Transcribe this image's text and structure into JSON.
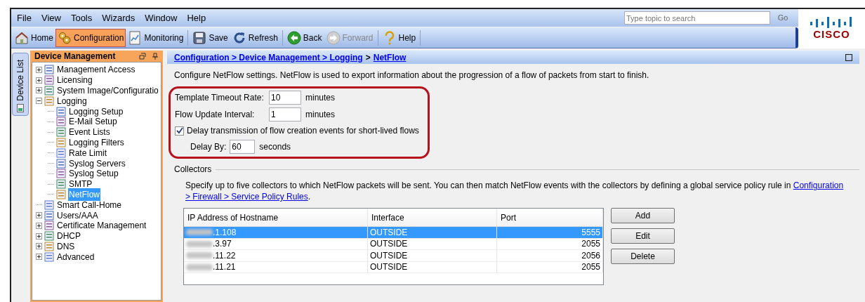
{
  "menu": [
    "File",
    "View",
    "Tools",
    "Wizards",
    "Window",
    "Help"
  ],
  "search": {
    "placeholder": "Type topic to search",
    "button": "Go"
  },
  "logo": "CISCO",
  "toolbar": [
    {
      "label": "Home",
      "kind": "home",
      "selected": false,
      "disabled": false
    },
    {
      "label": "Configuration",
      "kind": "gears",
      "selected": true,
      "disabled": false
    },
    {
      "label": "Monitoring",
      "kind": "chart",
      "selected": false,
      "disabled": false
    },
    {
      "label": "Save",
      "kind": "disk",
      "selected": false,
      "disabled": false
    },
    {
      "label": "Refresh",
      "kind": "refresh",
      "selected": false,
      "disabled": false
    },
    {
      "label": "Back",
      "kind": "back",
      "selected": false,
      "disabled": false
    },
    {
      "label": "Forward",
      "kind": "forward",
      "selected": false,
      "disabled": true
    },
    {
      "label": "Help",
      "kind": "help",
      "selected": false,
      "disabled": false
    }
  ],
  "side_tab": "Device List",
  "sidebar": {
    "title": "Device Management",
    "items": [
      {
        "label": "Management Access",
        "expanded": false,
        "selected": false
      },
      {
        "label": "Licensing",
        "expanded": false,
        "selected": false
      },
      {
        "label": "System Image/Configuratio",
        "expanded": false,
        "selected": false
      },
      {
        "label": "Logging",
        "expanded": true,
        "selected": false,
        "children": [
          {
            "label": "Logging Setup",
            "selected": false
          },
          {
            "label": "E-Mail Setup",
            "selected": false
          },
          {
            "label": "Event Lists",
            "selected": false
          },
          {
            "label": "Logging Filters",
            "selected": false
          },
          {
            "label": "Rate Limit",
            "selected": false
          },
          {
            "label": "Syslog Servers",
            "selected": false
          },
          {
            "label": "Syslog Setup",
            "selected": false
          },
          {
            "label": "SMTP",
            "selected": false
          },
          {
            "label": "NetFlow",
            "selected": true
          }
        ]
      },
      {
        "label": "Smart Call-Home",
        "selected": false
      },
      {
        "label": "Users/AAA",
        "expanded": false,
        "selected": false
      },
      {
        "label": "Certificate Management",
        "expanded": false,
        "selected": false
      },
      {
        "label": "DHCP",
        "expanded": false,
        "selected": false
      },
      {
        "label": "DNS",
        "expanded": false,
        "selected": false
      },
      {
        "label": "Advanced",
        "expanded": false,
        "selected": false
      }
    ]
  },
  "breadcrumb": [
    {
      "label": "Configuration > Device Management > Logging",
      "link": true
    },
    {
      "label": ">",
      "link": false
    },
    {
      "label": "NetFlow",
      "link": true
    }
  ],
  "description": "Configure NetFlow settings. NetFlow is used to export information about the progression of a flow of packets from start to finish.",
  "settings": {
    "template_timeout": {
      "label": "Template Timeout Rate:",
      "value": "10",
      "unit": "minutes"
    },
    "flow_update": {
      "label": "Flow Update Interval:",
      "value": "1",
      "unit": "minutes"
    },
    "delay": {
      "label": "Delay transmission of flow creation events for short-lived flows",
      "checked": true
    },
    "delay_by": {
      "label": "Delay By:",
      "value": "60",
      "unit": "seconds"
    }
  },
  "collectors": {
    "title": "Collectors",
    "text": "Specify up to five collectors to which NetFlow packets will be sent. You can then match NetFlow events with the collectors by defining a global service policy rule in ",
    "link_1": "Configuration",
    "link_2": "> Firewall > Service Policy Rules",
    "end": ".",
    "columns": [
      "IP Address of Hostname",
      "Interface",
      "Port"
    ],
    "rows": [
      {
        "cells": [
          ".1.108",
          "OUTSIDE",
          "5555"
        ],
        "selected": true
      },
      {
        "cells": [
          ".3.97",
          "OUTSIDE",
          "2055"
        ],
        "selected": false
      },
      {
        "cells": [
          ".11.22",
          "OUTSIDE",
          "2056"
        ],
        "selected": false
      },
      {
        "cells": [
          ".11.21",
          "OUTSIDE",
          "2055"
        ],
        "selected": false
      }
    ],
    "buttons": [
      "Add",
      "Edit",
      "Delete"
    ]
  }
}
